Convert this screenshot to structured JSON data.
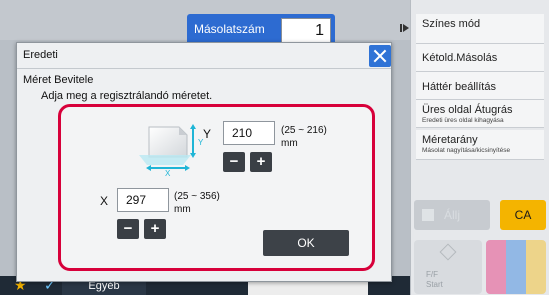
{
  "header": {
    "copies_label": "Másolatszám",
    "copies_value": "1"
  },
  "sidebar": {
    "items": [
      {
        "label": "Színes mód",
        "sub": ""
      },
      {
        "label": "Kétold.Másolás",
        "sub": ""
      },
      {
        "label": "Háttér beállítás",
        "sub": ""
      },
      {
        "label": "Üres oldal Átugrás",
        "sub": "Eredeti üres oldal kihagyása"
      },
      {
        "label": "Méretarány",
        "sub": "Másolat nagyítása/kicsinyítése"
      }
    ]
  },
  "controls": {
    "stop_label": "Állj",
    "ca_label": "CA",
    "start_line1": "F/F",
    "start_line2": "Start",
    "start_colors": [
      "#e64a8b",
      "#4c8fe0",
      "#f2c23a"
    ]
  },
  "bottom_bar": {
    "other_label": "Egyéb"
  },
  "dialog": {
    "title": "Eredeti",
    "subtitle": "Méret Bevitele",
    "instruction": "Adja meg a regisztrálandó méretet.",
    "y": {
      "label": "Y",
      "value": "210",
      "range": "(25 ~ 216)",
      "unit": "mm"
    },
    "x": {
      "label": "X",
      "value": "297",
      "range": "(25 ~ 356)",
      "unit": "mm"
    },
    "minus_label": "−",
    "plus_label": "+",
    "ok_label": "OK"
  },
  "icon_labels": {
    "paper_x": "X",
    "paper_y": "Y"
  },
  "colors": {
    "accent_blue": "#2f73d6",
    "frame_red": "#d7003a",
    "ca_yellow": "#f4b400",
    "icon_cyan": "#1fb5d6"
  }
}
